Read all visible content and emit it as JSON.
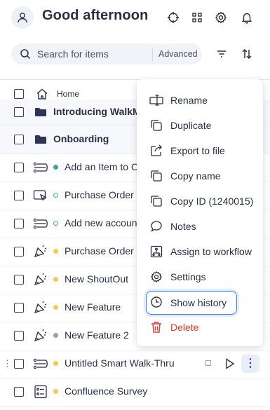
{
  "header": {
    "greeting": "Good afternoon",
    "icons": [
      "user-icon",
      "crosshair-icon",
      "grid-icon",
      "gear-icon",
      "bell-icon"
    ]
  },
  "search": {
    "placeholder": "Search for items",
    "advanced_label": "Advanced"
  },
  "breadcrumb": {
    "label": "Home"
  },
  "list": [
    {
      "label": "Introducing WalkMe",
      "icon": "folder-icon",
      "bold": true
    },
    {
      "label": "Onboarding",
      "icon": "folder-icon",
      "bold": true
    },
    {
      "label": "Add an Item to C",
      "icon": "smart-walkthru-icon",
      "status": "green"
    },
    {
      "label": "Purchase Order F",
      "icon": "cursor-box-icon",
      "status": "green-ring"
    },
    {
      "label": "Add new accoun",
      "icon": "smart-walkthru-icon",
      "status": "green-ring"
    },
    {
      "label": "Purchase Order F",
      "icon": "shoutout-icon",
      "status": "yellow"
    },
    {
      "label": "New ShoutOut",
      "icon": "shoutout-icon",
      "status": "yellow"
    },
    {
      "label": "New Feature",
      "icon": "shoutout-icon",
      "status": "yellow"
    },
    {
      "label": "New Feature 2",
      "icon": "shoutout-icon",
      "status": "grey"
    },
    {
      "label": "Untitled Smart Walk-Thru",
      "icon": "smart-walkthru-icon",
      "status": "yellow"
    },
    {
      "label": "Confluence Survey",
      "icon": "survey-icon",
      "status": "yellow"
    }
  ],
  "menu": {
    "items": [
      {
        "label": "Rename",
        "icon": "rename-icon"
      },
      {
        "label": "Duplicate",
        "icon": "duplicate-icon"
      },
      {
        "label": "Export to file",
        "icon": "export-icon"
      },
      {
        "label": "Copy name",
        "icon": "copy-icon"
      },
      {
        "label": "Copy ID (1240015)",
        "icon": "copy-icon"
      },
      {
        "label": "Notes",
        "icon": "notes-icon"
      },
      {
        "label": "Assign to workflow",
        "icon": "workflow-icon"
      },
      {
        "label": "Settings",
        "icon": "gear-icon"
      },
      {
        "label": "Show history",
        "icon": "history-icon"
      },
      {
        "label": "Delete",
        "icon": "trash-icon"
      }
    ]
  },
  "colors": {
    "text": "#2b2f46",
    "accent": "#3d7df0",
    "danger": "#e0392b",
    "status_green": "#3fa58f",
    "status_yellow": "#f2c94c",
    "status_grey": "#9aa0ae"
  }
}
